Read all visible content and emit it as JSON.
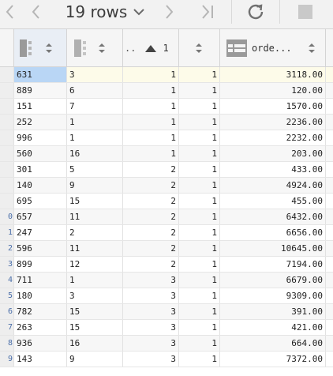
{
  "toolbar": {
    "rows_label": "19 rows",
    "icons": [
      "first-page-icon",
      "prev-page-icon",
      "rows-dropdown-icon",
      "next-page-icon",
      "last-page-icon",
      "refresh-icon",
      "stop-icon"
    ]
  },
  "header": {
    "col3_label": "1",
    "col5_label": "orde..."
  },
  "table": {
    "rows": [
      {
        "rn": "",
        "c1": "631",
        "c2": "3",
        "c3": "1",
        "c4": "1",
        "c5": "3118.00"
      },
      {
        "rn": "",
        "c1": "889",
        "c2": "6",
        "c3": "1",
        "c4": "1",
        "c5": "120.00"
      },
      {
        "rn": "",
        "c1": "151",
        "c2": "7",
        "c3": "1",
        "c4": "1",
        "c5": "1570.00"
      },
      {
        "rn": "",
        "c1": "252",
        "c2": "1",
        "c3": "1",
        "c4": "1",
        "c5": "2236.00"
      },
      {
        "rn": "",
        "c1": "996",
        "c2": "1",
        "c3": "1",
        "c4": "1",
        "c5": "2232.00"
      },
      {
        "rn": "",
        "c1": "560",
        "c2": "16",
        "c3": "1",
        "c4": "1",
        "c5": "203.00"
      },
      {
        "rn": "",
        "c1": "301",
        "c2": "5",
        "c3": "2",
        "c4": "1",
        "c5": "433.00"
      },
      {
        "rn": "",
        "c1": "140",
        "c2": "9",
        "c3": "2",
        "c4": "1",
        "c5": "4924.00"
      },
      {
        "rn": "",
        "c1": "695",
        "c2": "15",
        "c3": "2",
        "c4": "1",
        "c5": "455.00"
      },
      {
        "rn": "0",
        "c1": "657",
        "c2": "11",
        "c3": "2",
        "c4": "1",
        "c5": "6432.00"
      },
      {
        "rn": "1",
        "c1": "247",
        "c2": "2",
        "c3": "2",
        "c4": "1",
        "c5": "6656.00"
      },
      {
        "rn": "2",
        "c1": "596",
        "c2": "11",
        "c3": "2",
        "c4": "1",
        "c5": "10645.00"
      },
      {
        "rn": "3",
        "c1": "899",
        "c2": "12",
        "c3": "2",
        "c4": "1",
        "c5": "7194.00"
      },
      {
        "rn": "4",
        "c1": "711",
        "c2": "1",
        "c3": "3",
        "c4": "1",
        "c5": "6679.00"
      },
      {
        "rn": "5",
        "c1": "180",
        "c2": "3",
        "c3": "3",
        "c4": "1",
        "c5": "9309.00"
      },
      {
        "rn": "6",
        "c1": "782",
        "c2": "15",
        "c3": "3",
        "c4": "1",
        "c5": "391.00"
      },
      {
        "rn": "7",
        "c1": "263",
        "c2": "15",
        "c3": "3",
        "c4": "1",
        "c5": "421.00"
      },
      {
        "rn": "8",
        "c1": "936",
        "c2": "16",
        "c3": "3",
        "c4": "1",
        "c5": "664.00"
      },
      {
        "rn": "9",
        "c1": "143",
        "c2": "9",
        "c3": "3",
        "c4": "1",
        "c5": "7372.00"
      }
    ]
  }
}
